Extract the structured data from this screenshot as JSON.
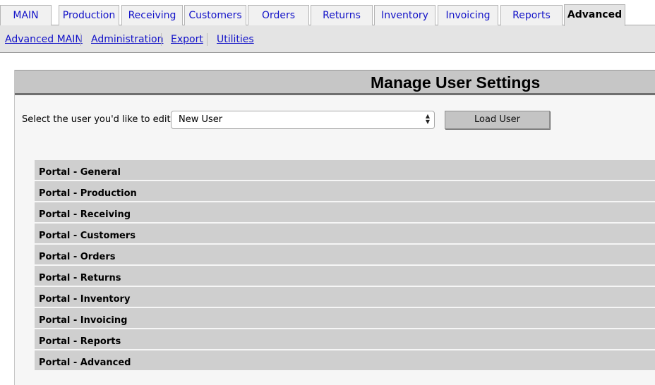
{
  "tabs": [
    {
      "label": "MAIN",
      "active": false
    },
    {
      "label": "Production",
      "active": false
    },
    {
      "label": "Receiving",
      "active": false
    },
    {
      "label": "Customers",
      "active": false
    },
    {
      "label": "Orders",
      "active": false
    },
    {
      "label": "Returns",
      "active": false
    },
    {
      "label": "Inventory",
      "active": false
    },
    {
      "label": "Invoicing",
      "active": false
    },
    {
      "label": "Reports",
      "active": false
    },
    {
      "label": "Advanced",
      "active": true
    }
  ],
  "subnav": [
    {
      "label": "Advanced MAIN"
    },
    {
      "label": "Administration"
    },
    {
      "label": "Export"
    },
    {
      "label": "Utilities"
    }
  ],
  "panel": {
    "title": "Manage User Settings",
    "select_label": "Select the user you'd like to edit:",
    "select_value": "New User",
    "load_button": "Load User"
  },
  "sections": [
    {
      "label": "Portal - General"
    },
    {
      "label": "Portal - Production"
    },
    {
      "label": "Portal - Receiving"
    },
    {
      "label": "Portal - Customers"
    },
    {
      "label": "Portal - Orders"
    },
    {
      "label": "Portal - Returns"
    },
    {
      "label": "Portal - Inventory"
    },
    {
      "label": "Portal - Invoicing"
    },
    {
      "label": "Portal - Reports"
    },
    {
      "label": "Portal - Advanced"
    }
  ],
  "colors": {
    "link": "#1212c8",
    "section_bg": "#cfcfcf",
    "header_bg": "#c6c6c6",
    "subnav_bg": "#e4e4e4",
    "panel_bg": "#f6f6f6"
  }
}
